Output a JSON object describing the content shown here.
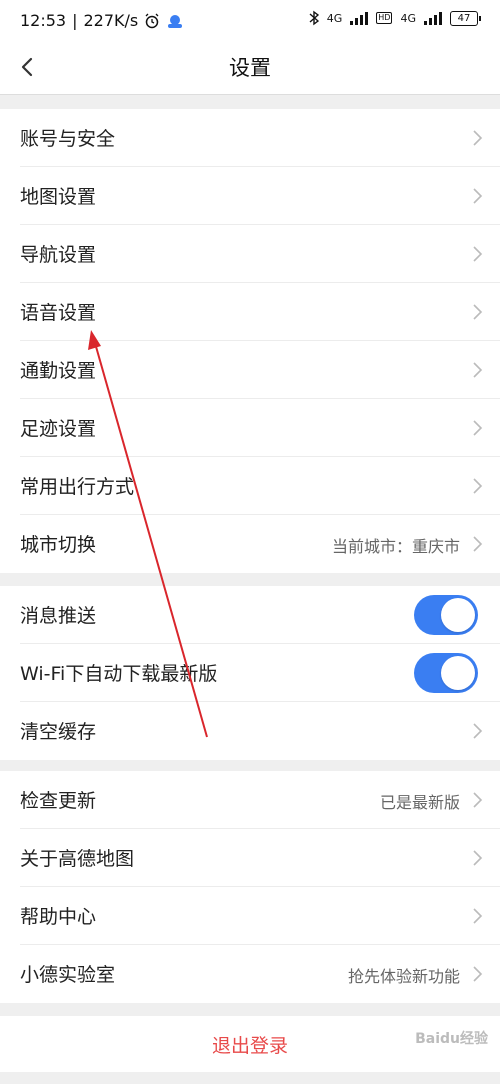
{
  "status_bar": {
    "time": "12:53",
    "speed": "227K/s",
    "net1": "4G",
    "hd": "HD",
    "net2": "4G",
    "battery": "47"
  },
  "header": {
    "title": "设置"
  },
  "groups": [
    {
      "items": [
        {
          "label": "账号与安全"
        },
        {
          "label": "地图设置"
        },
        {
          "label": "导航设置"
        },
        {
          "label": "语音设置"
        },
        {
          "label": "通勤设置"
        },
        {
          "label": "足迹设置"
        },
        {
          "label": "常用出行方式"
        },
        {
          "label": "城市切换",
          "value": "当前城市：重庆市"
        }
      ]
    },
    {
      "items": [
        {
          "label": "消息推送",
          "toggle": true
        },
        {
          "label": "Wi-Fi下自动下载最新版",
          "toggle": true
        },
        {
          "label": "清空缓存"
        }
      ]
    },
    {
      "items": [
        {
          "label": "检查更新",
          "value": "已是最新版"
        },
        {
          "label": "关于高德地图"
        },
        {
          "label": "帮助中心"
        },
        {
          "label": "小德实验室",
          "value": "抢先体验新功能"
        }
      ]
    }
  ],
  "logout_label": "退出登录",
  "annotation_color": "#d9262c",
  "accent_color": "#3a7ef2",
  "watermark": "Baidu经验"
}
